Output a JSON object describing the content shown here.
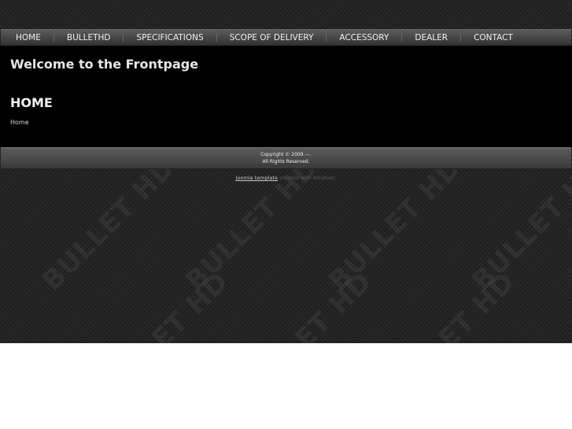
{
  "navigation": {
    "items": [
      "HOME",
      "BULLETHD",
      "SPECIFICATIONS",
      "SCOPE OF DELIVERY",
      "ACCESSORY",
      "DEALER",
      "CONTACT"
    ]
  },
  "content": {
    "welcome_heading": "Welcome to the Frontpage",
    "section_heading": "HOME",
    "breadcrumb": "Home"
  },
  "footer": {
    "copyright": "Copyright © 2009 ---.",
    "rights": "All Rights Reserved."
  },
  "credit": {
    "link_text": "Joomla template",
    "trailing_text": " created with Artisteer."
  },
  "background": {
    "watermark_text": "BULLET HD",
    "page_color": "#242424",
    "content_color": "#000000"
  }
}
